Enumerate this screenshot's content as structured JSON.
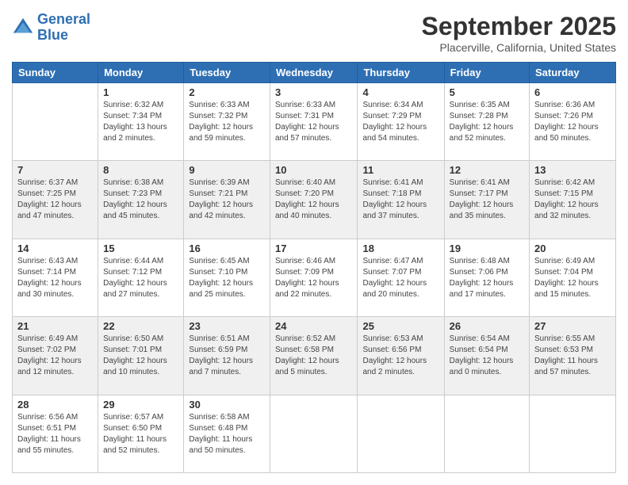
{
  "header": {
    "logo_line1": "General",
    "logo_line2": "Blue",
    "month_title": "September 2025",
    "location": "Placerville, California, United States"
  },
  "weekdays": [
    "Sunday",
    "Monday",
    "Tuesday",
    "Wednesday",
    "Thursday",
    "Friday",
    "Saturday"
  ],
  "weeks": [
    [
      {
        "day": "",
        "info": ""
      },
      {
        "day": "1",
        "info": "Sunrise: 6:32 AM\nSunset: 7:34 PM\nDaylight: 13 hours\nand 2 minutes."
      },
      {
        "day": "2",
        "info": "Sunrise: 6:33 AM\nSunset: 7:32 PM\nDaylight: 12 hours\nand 59 minutes."
      },
      {
        "day": "3",
        "info": "Sunrise: 6:33 AM\nSunset: 7:31 PM\nDaylight: 12 hours\nand 57 minutes."
      },
      {
        "day": "4",
        "info": "Sunrise: 6:34 AM\nSunset: 7:29 PM\nDaylight: 12 hours\nand 54 minutes."
      },
      {
        "day": "5",
        "info": "Sunrise: 6:35 AM\nSunset: 7:28 PM\nDaylight: 12 hours\nand 52 minutes."
      },
      {
        "day": "6",
        "info": "Sunrise: 6:36 AM\nSunset: 7:26 PM\nDaylight: 12 hours\nand 50 minutes."
      }
    ],
    [
      {
        "day": "7",
        "info": "Sunrise: 6:37 AM\nSunset: 7:25 PM\nDaylight: 12 hours\nand 47 minutes."
      },
      {
        "day": "8",
        "info": "Sunrise: 6:38 AM\nSunset: 7:23 PM\nDaylight: 12 hours\nand 45 minutes."
      },
      {
        "day": "9",
        "info": "Sunrise: 6:39 AM\nSunset: 7:21 PM\nDaylight: 12 hours\nand 42 minutes."
      },
      {
        "day": "10",
        "info": "Sunrise: 6:40 AM\nSunset: 7:20 PM\nDaylight: 12 hours\nand 40 minutes."
      },
      {
        "day": "11",
        "info": "Sunrise: 6:41 AM\nSunset: 7:18 PM\nDaylight: 12 hours\nand 37 minutes."
      },
      {
        "day": "12",
        "info": "Sunrise: 6:41 AM\nSunset: 7:17 PM\nDaylight: 12 hours\nand 35 minutes."
      },
      {
        "day": "13",
        "info": "Sunrise: 6:42 AM\nSunset: 7:15 PM\nDaylight: 12 hours\nand 32 minutes."
      }
    ],
    [
      {
        "day": "14",
        "info": "Sunrise: 6:43 AM\nSunset: 7:14 PM\nDaylight: 12 hours\nand 30 minutes."
      },
      {
        "day": "15",
        "info": "Sunrise: 6:44 AM\nSunset: 7:12 PM\nDaylight: 12 hours\nand 27 minutes."
      },
      {
        "day": "16",
        "info": "Sunrise: 6:45 AM\nSunset: 7:10 PM\nDaylight: 12 hours\nand 25 minutes."
      },
      {
        "day": "17",
        "info": "Sunrise: 6:46 AM\nSunset: 7:09 PM\nDaylight: 12 hours\nand 22 minutes."
      },
      {
        "day": "18",
        "info": "Sunrise: 6:47 AM\nSunset: 7:07 PM\nDaylight: 12 hours\nand 20 minutes."
      },
      {
        "day": "19",
        "info": "Sunrise: 6:48 AM\nSunset: 7:06 PM\nDaylight: 12 hours\nand 17 minutes."
      },
      {
        "day": "20",
        "info": "Sunrise: 6:49 AM\nSunset: 7:04 PM\nDaylight: 12 hours\nand 15 minutes."
      }
    ],
    [
      {
        "day": "21",
        "info": "Sunrise: 6:49 AM\nSunset: 7:02 PM\nDaylight: 12 hours\nand 12 minutes."
      },
      {
        "day": "22",
        "info": "Sunrise: 6:50 AM\nSunset: 7:01 PM\nDaylight: 12 hours\nand 10 minutes."
      },
      {
        "day": "23",
        "info": "Sunrise: 6:51 AM\nSunset: 6:59 PM\nDaylight: 12 hours\nand 7 minutes."
      },
      {
        "day": "24",
        "info": "Sunrise: 6:52 AM\nSunset: 6:58 PM\nDaylight: 12 hours\nand 5 minutes."
      },
      {
        "day": "25",
        "info": "Sunrise: 6:53 AM\nSunset: 6:56 PM\nDaylight: 12 hours\nand 2 minutes."
      },
      {
        "day": "26",
        "info": "Sunrise: 6:54 AM\nSunset: 6:54 PM\nDaylight: 12 hours\nand 0 minutes."
      },
      {
        "day": "27",
        "info": "Sunrise: 6:55 AM\nSunset: 6:53 PM\nDaylight: 11 hours\nand 57 minutes."
      }
    ],
    [
      {
        "day": "28",
        "info": "Sunrise: 6:56 AM\nSunset: 6:51 PM\nDaylight: 11 hours\nand 55 minutes."
      },
      {
        "day": "29",
        "info": "Sunrise: 6:57 AM\nSunset: 6:50 PM\nDaylight: 11 hours\nand 52 minutes."
      },
      {
        "day": "30",
        "info": "Sunrise: 6:58 AM\nSunset: 6:48 PM\nDaylight: 11 hours\nand 50 minutes."
      },
      {
        "day": "",
        "info": ""
      },
      {
        "day": "",
        "info": ""
      },
      {
        "day": "",
        "info": ""
      },
      {
        "day": "",
        "info": ""
      }
    ]
  ]
}
